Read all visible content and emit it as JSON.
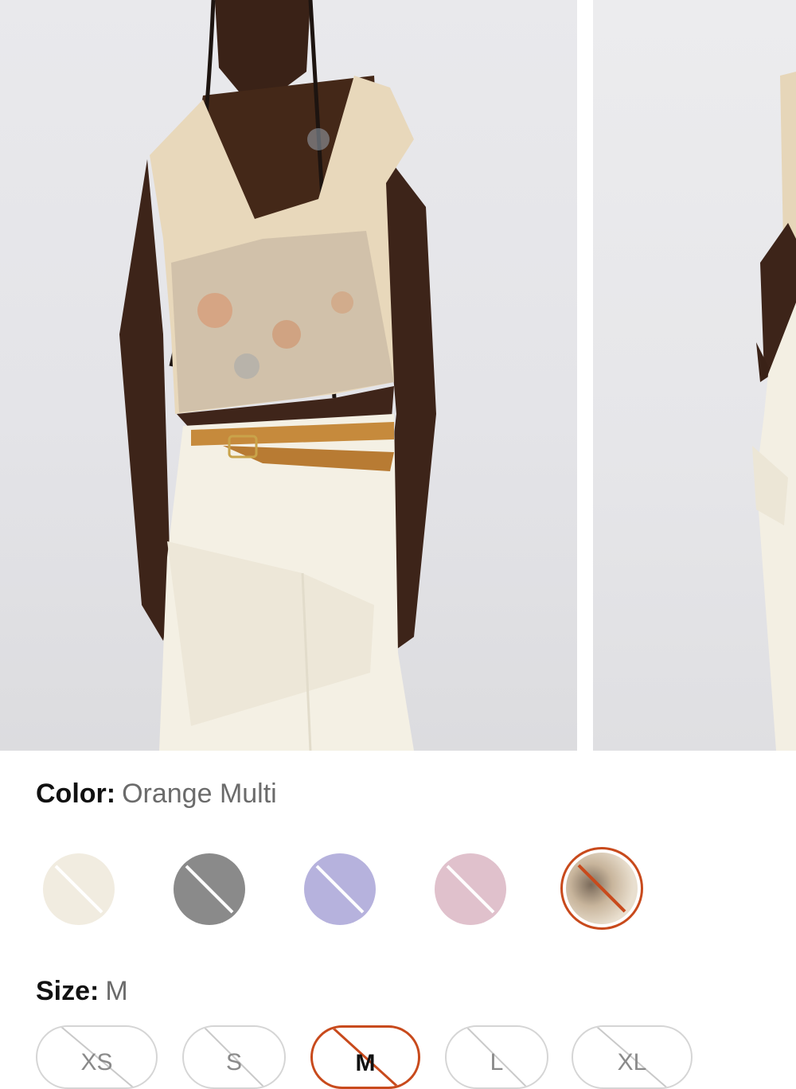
{
  "product_images": [
    {
      "name": "Model front view"
    },
    {
      "name": "Model side view"
    }
  ],
  "color": {
    "label": "Color:",
    "selected": "Orange Multi",
    "swatches": [
      {
        "name": "cream",
        "hex": "#f1ece0",
        "unavailable": true
      },
      {
        "name": "grey",
        "hex": "#8a8a8a",
        "unavailable": true
      },
      {
        "name": "lavender",
        "hex": "#b6b2dd",
        "unavailable": true
      },
      {
        "name": "pink",
        "hex": "#e0c1cc",
        "unavailable": true
      },
      {
        "name": "orange-multi",
        "hex": "#c9b9a2",
        "unavailable": true,
        "selected": true
      }
    ]
  },
  "size": {
    "label": "Size:",
    "selected": "M",
    "options": [
      {
        "label": "XS",
        "unavailable": true
      },
      {
        "label": "S",
        "unavailable": true
      },
      {
        "label": "M",
        "unavailable": true,
        "selected": true
      },
      {
        "label": "L",
        "unavailable": true
      },
      {
        "label": "XL",
        "unavailable": true
      }
    ]
  },
  "accent_color": "#c84a1c"
}
